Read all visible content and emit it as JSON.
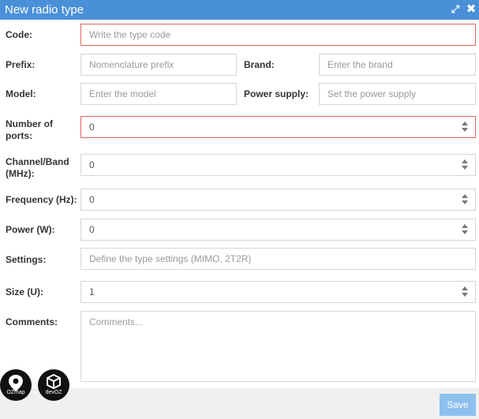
{
  "window": {
    "title": "New radio type"
  },
  "form": {
    "code": {
      "label": "Code:",
      "placeholder": "Write the type code",
      "value": ""
    },
    "prefix": {
      "label": "Prefix:",
      "placeholder": "Nomenclature prefix",
      "value": ""
    },
    "brand": {
      "label": "Brand:",
      "placeholder": "Enter the brand",
      "value": ""
    },
    "model": {
      "label": "Model:",
      "placeholder": "Enter the model",
      "value": ""
    },
    "power_supply": {
      "label": "Power supply:",
      "placeholder": "Set the power supply",
      "value": ""
    },
    "ports": {
      "label_line1": "Number of",
      "label_line2": "ports:",
      "value": "0"
    },
    "channel_band": {
      "label_line1": "Channel/Band",
      "label_line2": "(MHz):",
      "value": "0"
    },
    "frequency": {
      "label": "Frequency (Hz):",
      "value": "0"
    },
    "power": {
      "label": "Power (W):",
      "value": "0"
    },
    "settings": {
      "label": "Settings:",
      "placeholder": "Define the type settings (MIMO, 2T2R)",
      "value": ""
    },
    "size": {
      "label": "Size (U):",
      "value": "1"
    },
    "comments": {
      "label": "Comments:",
      "placeholder": "Comments..."
    }
  },
  "footer": {
    "save_label": "Save"
  },
  "logos": {
    "ozmap": "OZmap",
    "devoz": "devOZ"
  },
  "colors": {
    "titlebar": "#4a90d9",
    "error_border": "#e0635b",
    "save_button": "#8ec0ee"
  }
}
